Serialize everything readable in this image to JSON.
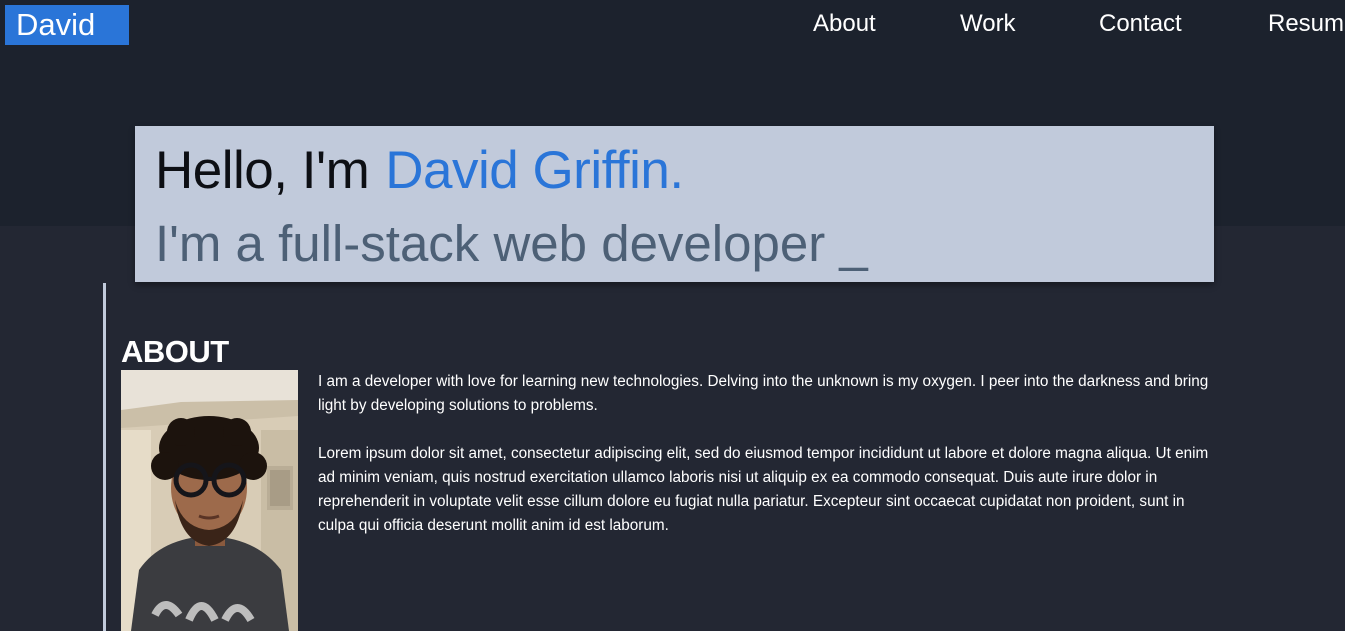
{
  "header": {
    "brand": "David",
    "nav": {
      "about": "About",
      "work": "Work",
      "contact": "Contact",
      "resume": "Resume"
    }
  },
  "hero": {
    "greeting_prefix": "Hello, I'm",
    "name": "David Griffin.",
    "tagline": "I'm a full-stack web developer _"
  },
  "about": {
    "heading": "ABOUT",
    "paragraph_1": "I am a developer with love for learning new technologies. Delving into the unknown is my oxygen. I peer into the darkness and bring light by developing solutions to problems.",
    "paragraph_2": "Lorem ipsum dolor sit amet, consectetur adipiscing elit, sed do eiusmod tempor incididunt ut labore et dolore magna aliqua. Ut enim ad minim veniam, quis nostrud exercitation ullamco laboris nisi ut aliquip ex ea commodo consequat. Duis aute irure dolor in reprehenderit in voluptate velit esse cillum dolore eu fugiat nulla pariatur. Excepteur sint occaecat cupidatat non proident, sunt in culpa qui officia deserunt mollit anim id est laborum."
  },
  "colors": {
    "accent": "#2a75d8",
    "hero_background": "#1c222d",
    "page_background": "#232733",
    "card_background": "#c1cadb",
    "tagline_text": "#4d6076"
  }
}
